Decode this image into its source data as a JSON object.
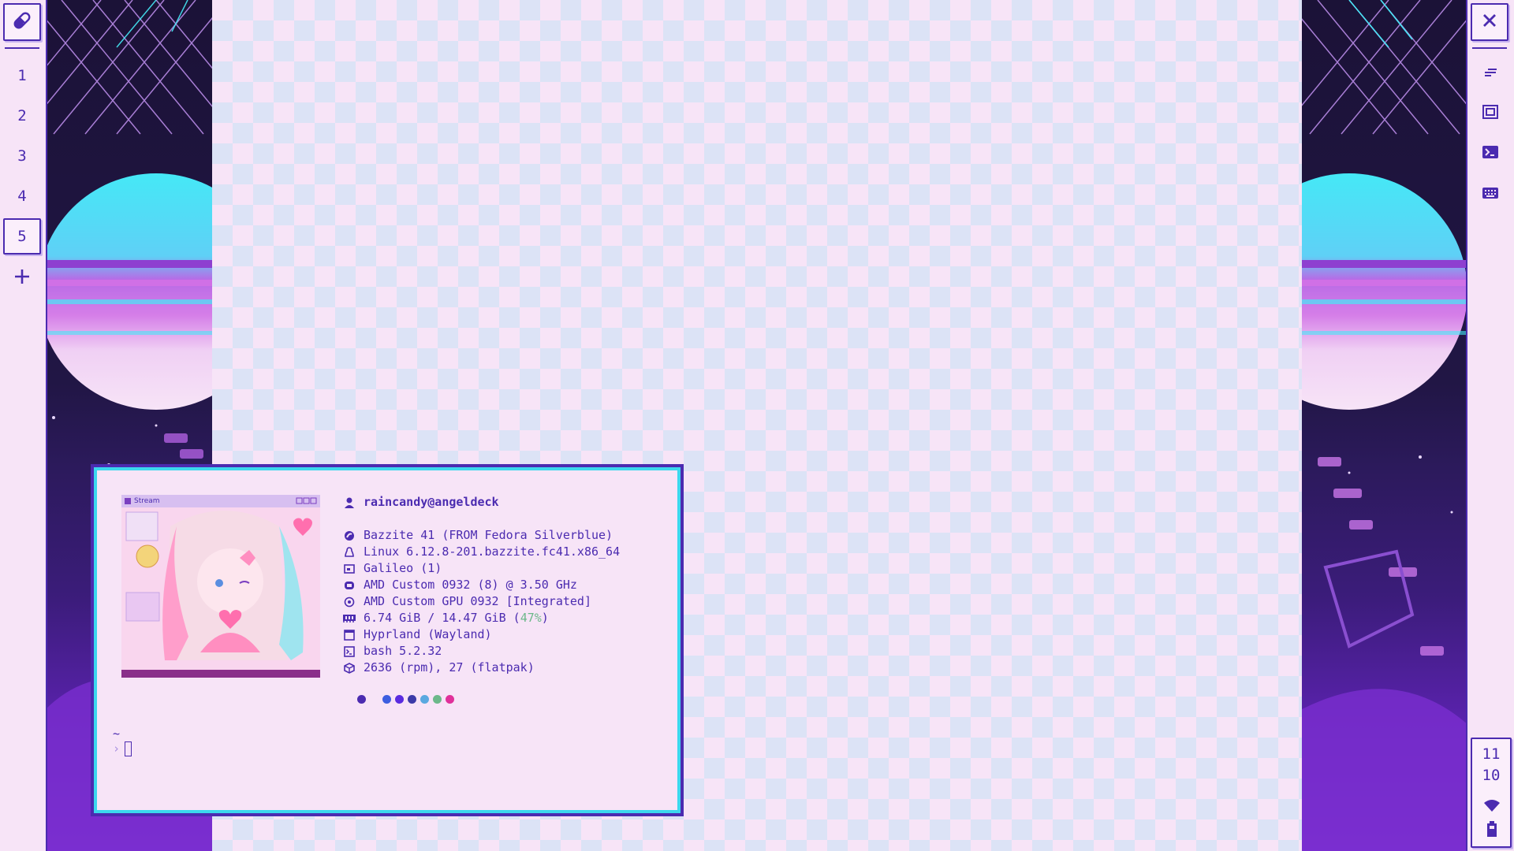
{
  "left_bar": {
    "workspaces": [
      {
        "label": "1",
        "active": false
      },
      {
        "label": "2",
        "active": false
      },
      {
        "label": "3",
        "active": false
      },
      {
        "label": "4",
        "active": false
      },
      {
        "label": "5",
        "active": true
      }
    ],
    "icons": {
      "launcher": "pill-icon",
      "add": "plus-icon"
    }
  },
  "right_bar": {
    "icons": [
      "close-icon",
      "notes-icon",
      "fullscreen-icon",
      "terminal-icon",
      "keyboard-icon",
      "wifi-icon",
      "battery-icon"
    ],
    "clock": {
      "hour": "11",
      "minute": "10"
    }
  },
  "terminal": {
    "image_caption": "Stream",
    "user": "raincandy@angeldeck",
    "rows": [
      {
        "icon": "os-icon",
        "text": "Bazzite 41 (FROM Fedora Silverblue)"
      },
      {
        "icon": "linux-icon",
        "text": "Linux 6.12.8-201.bazzite.fc41.x86_64"
      },
      {
        "icon": "host-icon",
        "text": "Galileo (1)"
      },
      {
        "icon": "cpu-icon",
        "text": "AMD Custom 0932 (8) @ 3.50 GHz"
      },
      {
        "icon": "gpu-icon",
        "text": "AMD Custom GPU 0932 [Integrated]"
      },
      {
        "icon": "memory-icon",
        "text_main": "6.74 GiB / 14.47 GiB (",
        "text_pct": "47%",
        "text_end": ")"
      },
      {
        "icon": "window-icon",
        "text": "Hyprland (Wayland)"
      },
      {
        "icon": "shell-icon",
        "text": "bash 5.2.32"
      },
      {
        "icon": "package-icon",
        "text": "2636 (rpm), 27 (flatpak)"
      }
    ],
    "palette": [
      "#4b2bb0",
      "#f7e4f7",
      "#3c5ee0",
      "#5a2be0",
      "#3b3aa8",
      "#5aa8e0",
      "#6cb88a",
      "#e0309a"
    ],
    "prompt_dir": "~",
    "prompt_symbol": "›"
  }
}
